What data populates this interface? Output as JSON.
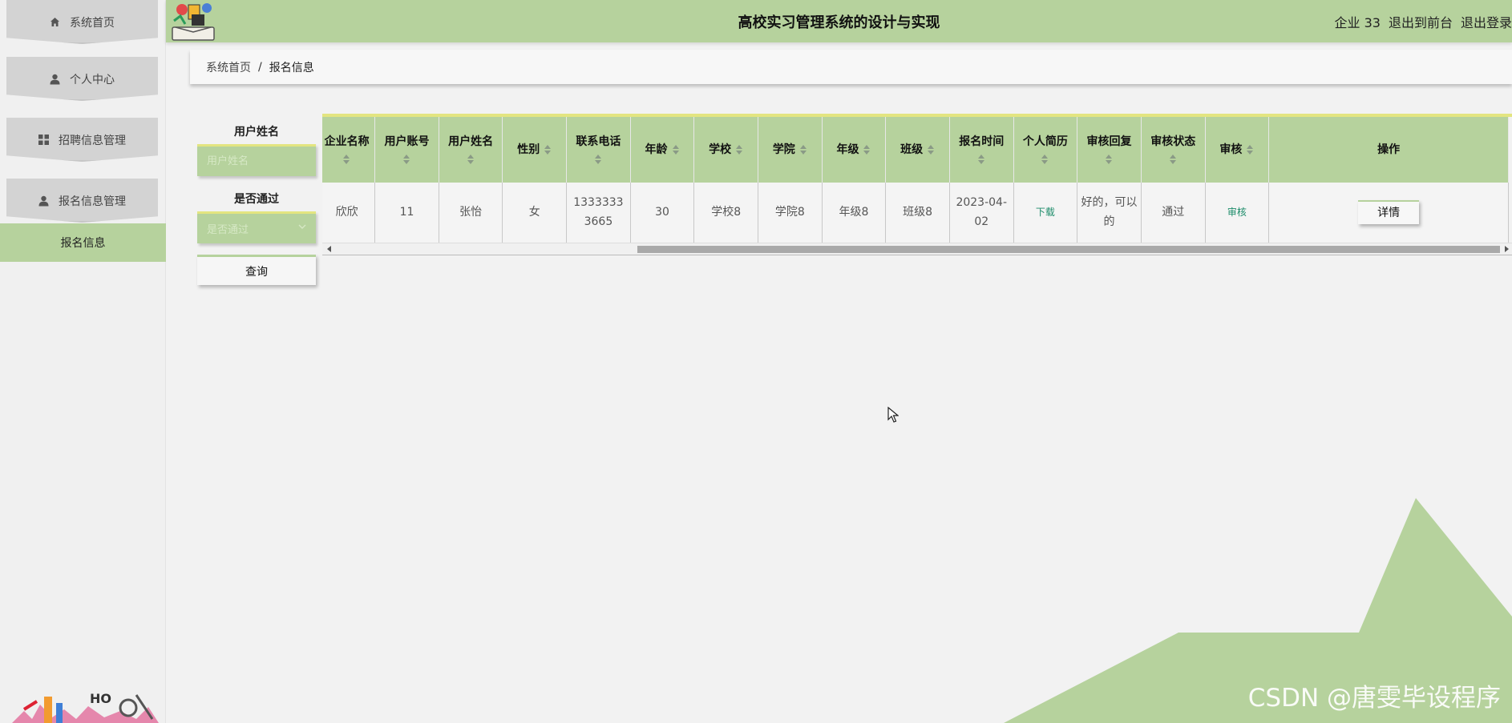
{
  "header": {
    "title": "高校实习管理系统的设计与实现",
    "company": "企业 33",
    "exit_front": "退出到前台",
    "logout": "退出登录"
  },
  "sidebar": {
    "items": [
      {
        "label": "系统首页",
        "icon": "home-icon"
      },
      {
        "label": "个人中心",
        "icon": "user-icon"
      },
      {
        "label": "招聘信息管理",
        "icon": "grid-icon"
      },
      {
        "label": "报名信息管理",
        "icon": "user-icon"
      }
    ],
    "sub_item": "报名信息"
  },
  "breadcrumb": {
    "home": "系统首页",
    "separator": "/",
    "current": "报名信息"
  },
  "search": {
    "name_label": "用户姓名",
    "name_placeholder": "用户姓名",
    "pass_label": "是否通过",
    "pass_placeholder": "是否通过",
    "query_button": "查询"
  },
  "table": {
    "columns": [
      "企业名称",
      "用户账号",
      "用户姓名",
      "性别",
      "联系电话",
      "年龄",
      "学校",
      "学院",
      "年级",
      "班级",
      "报名时间",
      "个人简历",
      "审核回复",
      "审核状态",
      "审核",
      "操作"
    ],
    "rows": [
      {
        "company": "欣欣",
        "account": "11",
        "name": "张怡",
        "gender": "女",
        "phone": "13333333665",
        "age": "30",
        "school": "学校8",
        "college": "学院8",
        "grade": "年级8",
        "class": "班级8",
        "date": "2023-04-02",
        "resume": "下载",
        "reply": "好的，可以的",
        "status": "通过",
        "review": "审核",
        "detail": "详情"
      }
    ]
  },
  "watermark": "CSDN @唐雯毕设程序",
  "colors": {
    "accent_green": "#b6d29d",
    "accent_yellow": "#e3e580",
    "link_green": "#1d8c6a"
  }
}
